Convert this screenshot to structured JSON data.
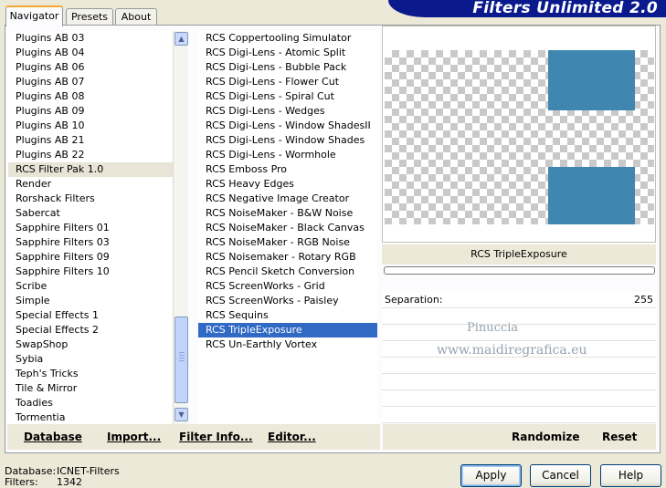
{
  "header": {
    "title": "Filters Unlimited 2.0"
  },
  "tabs": [
    {
      "label": "Navigator",
      "active": true
    },
    {
      "label": "Presets",
      "active": false
    },
    {
      "label": "About",
      "active": false
    }
  ],
  "categories": {
    "items": [
      "Plugins AB 03",
      "Plugins AB 04",
      "Plugins AB 06",
      "Plugins AB 07",
      "Plugins AB 08",
      "Plugins AB 09",
      "Plugins AB 10",
      "Plugins AB 21",
      "Plugins AB 22",
      "RCS Filter Pak 1.0",
      "Render",
      "Rorshack Filters",
      "Sabercat",
      "Sapphire Filters 01",
      "Sapphire Filters 03",
      "Sapphire Filters 09",
      "Sapphire Filters 10",
      "Scribe",
      "Simple",
      "Special Effects 1",
      "Special Effects 2",
      "SwapShop",
      "Sybia",
      "Teph's Tricks",
      "Tile & Mirror",
      "Toadies",
      "Tormentia"
    ],
    "selected": "RCS Filter Pak 1.0"
  },
  "filters": {
    "items": [
      "RCS Coppertooling Simulator",
      "RCS Digi-Lens - Atomic Split",
      "RCS Digi-Lens - Bubble Pack",
      "RCS Digi-Lens - Flower Cut",
      "RCS Digi-Lens - Spiral Cut",
      "RCS Digi-Lens - Wedges",
      "RCS Digi-Lens - Window ShadesII",
      "RCS Digi-Lens - Window Shades",
      "RCS Digi-Lens - Wormhole",
      "RCS Emboss Pro",
      "RCS Heavy Edges",
      "RCS Negative Image Creator",
      "RCS NoiseMaker - B&W Noise",
      "RCS NoiseMaker - Black Canvas",
      "RCS NoiseMaker - RGB Noise",
      "RCS Noisemaker - Rotary RGB",
      "RCS Pencil Sketch Conversion",
      "RCS ScreenWorks - Grid",
      "RCS ScreenWorks - Paisley",
      "RCS Sequins",
      "RCS TripleExposure",
      "RCS Un-Earthly Vortex"
    ],
    "selected": "RCS TripleExposure"
  },
  "preview": {
    "accent_color": "#3f86b0"
  },
  "current_filter": "RCS TripleExposure",
  "params": [
    {
      "label": "Separation:",
      "value": "255"
    }
  ],
  "watermark": {
    "line1": "Pinuccia",
    "line2": "www.maidiregrafica.eu"
  },
  "toolbar": {
    "database": "Database",
    "import": "Import...",
    "filter_info": "Filter Info...",
    "editor": "Editor...",
    "randomize": "Randomize",
    "reset": "Reset"
  },
  "status": {
    "database_label": "Database:",
    "database_value": "ICNET-Filters",
    "filters_label": "Filters:",
    "filters_value": "1342"
  },
  "buttons": {
    "apply": "Apply",
    "cancel": "Cancel",
    "help": "Help"
  }
}
